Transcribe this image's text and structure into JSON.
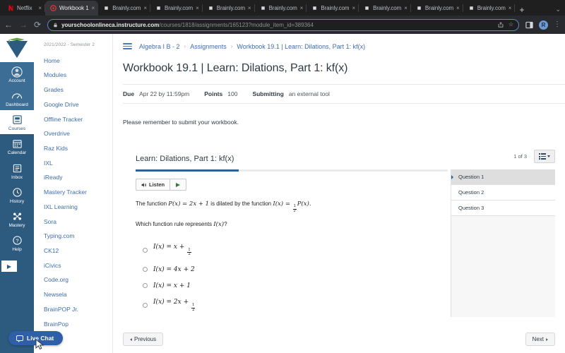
{
  "browser": {
    "tabs": [
      {
        "title": "Netflix",
        "favicon": "netflix-icon",
        "active": false,
        "close": "×"
      },
      {
        "title": "Workbook 1",
        "favicon": "canvas-icon",
        "active": true,
        "close": "×"
      },
      {
        "title": "Brainly.com",
        "favicon": "brainly-icon",
        "active": false,
        "close": "×"
      },
      {
        "title": "Brainly.com",
        "favicon": "brainly-icon",
        "active": false,
        "close": "×"
      },
      {
        "title": "Brainly.com",
        "favicon": "brainly-icon",
        "active": false,
        "close": "×"
      },
      {
        "title": "Brainly.com",
        "favicon": "brainly-icon",
        "active": false,
        "close": "×"
      },
      {
        "title": "Brainly.com",
        "favicon": "brainly-icon",
        "active": false,
        "close": "×"
      },
      {
        "title": "Brainly.com",
        "favicon": "brainly-icon",
        "active": false,
        "close": "×"
      },
      {
        "title": "Brainly.com",
        "favicon": "brainly-icon",
        "active": false,
        "close": "×"
      },
      {
        "title": "Brainly.com",
        "favicon": "brainly-icon",
        "active": false,
        "close": "×"
      }
    ],
    "new_tab_label": "+",
    "tabstrip_overflow": "⌄",
    "back": "←",
    "forward": "→",
    "reload": "⟳",
    "url_host": "yourschoolonlineca.instructure.com",
    "url_path": "/courses/1818/assignments/165123?module_item_id=389364",
    "share_icon": "share-icon",
    "bookmark_icon": "☆",
    "panel_icon": "side-panel-icon",
    "profile_initial": "R",
    "menu_icon": "⋮",
    "accent_blue": "#5b87d6"
  },
  "global_nav": {
    "logo": "yourschoolonline-logo",
    "items": [
      {
        "label": "Account",
        "icon": "account-icon",
        "state": "on"
      },
      {
        "label": "Dashboard",
        "icon": "dashboard-icon",
        "state": "on"
      },
      {
        "label": "Courses",
        "icon": "courses-icon",
        "state": "white"
      },
      {
        "label": "Calendar",
        "icon": "calendar-icon",
        "state": ""
      },
      {
        "label": "Inbox",
        "icon": "inbox-icon",
        "state": ""
      },
      {
        "label": "History",
        "icon": "history-clock-icon",
        "state": ""
      },
      {
        "label": "Mastery",
        "icon": "mastery-nodes-icon",
        "state": ""
      },
      {
        "label": "Help",
        "icon": "help-question-icon",
        "state": ""
      }
    ],
    "expand_label": "▶",
    "bg_color": "#2d5b80"
  },
  "course_nav": {
    "term": "2021/2022 - Semester 2",
    "items": [
      "Home",
      "Modules",
      "Grades",
      "Google Drive",
      "Offline Tracker",
      "Overdrive",
      "Raz Kids",
      "IXL",
      "iReady",
      "Mastery Tracker",
      "IXL Learning",
      "Sora",
      "Typing.com",
      "CK12",
      "iCivics",
      "Code.org",
      "Newsela",
      "BrainPOP Jr.",
      "BrainPop"
    ]
  },
  "breadcrumb": {
    "menu_icon": "hamburger-menu-icon",
    "items": [
      "Algebra I B - 2",
      "Assignments",
      "Workbook 19.1 | Learn: Dilations, Part 1: kf(x)"
    ],
    "separator": "›"
  },
  "assignment": {
    "title": "Workbook 19.1 | Learn: Dilations, Part 1: kf(x)",
    "due_label": "Due",
    "due_value": "Apr 22 by 11:59pm",
    "points_label": "Points",
    "points_value": "100",
    "submitting_label": "Submitting",
    "submitting_value": "an external tool",
    "description": "Please remember to submit your workbook."
  },
  "tool": {
    "title": "Learn: Dilations, Part 1: kf(x)",
    "counter": "1 of 3",
    "list_button_icon": "list-view-dropdown-icon",
    "progress_percent": 33,
    "listen_label": "Listen",
    "listen_icon": "speaker-icon",
    "play_icon": "play-triangle-icon",
    "question_stem_pre": "The function ",
    "question_stem_fn": "P(x) = 2x + 1",
    "question_stem_mid": " is dilated by the function ",
    "question_stem_fn2_pre": "I(x) = ",
    "question_stem_frac_num": "1",
    "question_stem_frac_den": "2",
    "question_stem_fn2_post": "P(x).",
    "prompt_pre": "Which function rule represents ",
    "prompt_fn": "I(x)",
    "prompt_post": "?",
    "choices": [
      {
        "prefix": "I(x) = x + ",
        "frac_num": "1",
        "frac_den": "2",
        "suffix": ""
      },
      {
        "prefix": "I(x) = 4x + 2",
        "frac_num": "",
        "frac_den": "",
        "suffix": ""
      },
      {
        "prefix": "I(x) = x + 1",
        "frac_num": "",
        "frac_den": "",
        "suffix": ""
      },
      {
        "prefix": "I(x) = 2x + ",
        "frac_num": "1",
        "frac_den": "2",
        "suffix": ""
      }
    ],
    "question_list": [
      {
        "label": "Question 1",
        "selected": true
      },
      {
        "label": "Question 2",
        "selected": false
      },
      {
        "label": "Question 3",
        "selected": false
      }
    ]
  },
  "pagenav": {
    "previous": "Previous",
    "next": "Next"
  },
  "live_chat": {
    "label": "Live Chat",
    "icon": "chat-bubble-icon",
    "color": "#2f5fa8"
  }
}
